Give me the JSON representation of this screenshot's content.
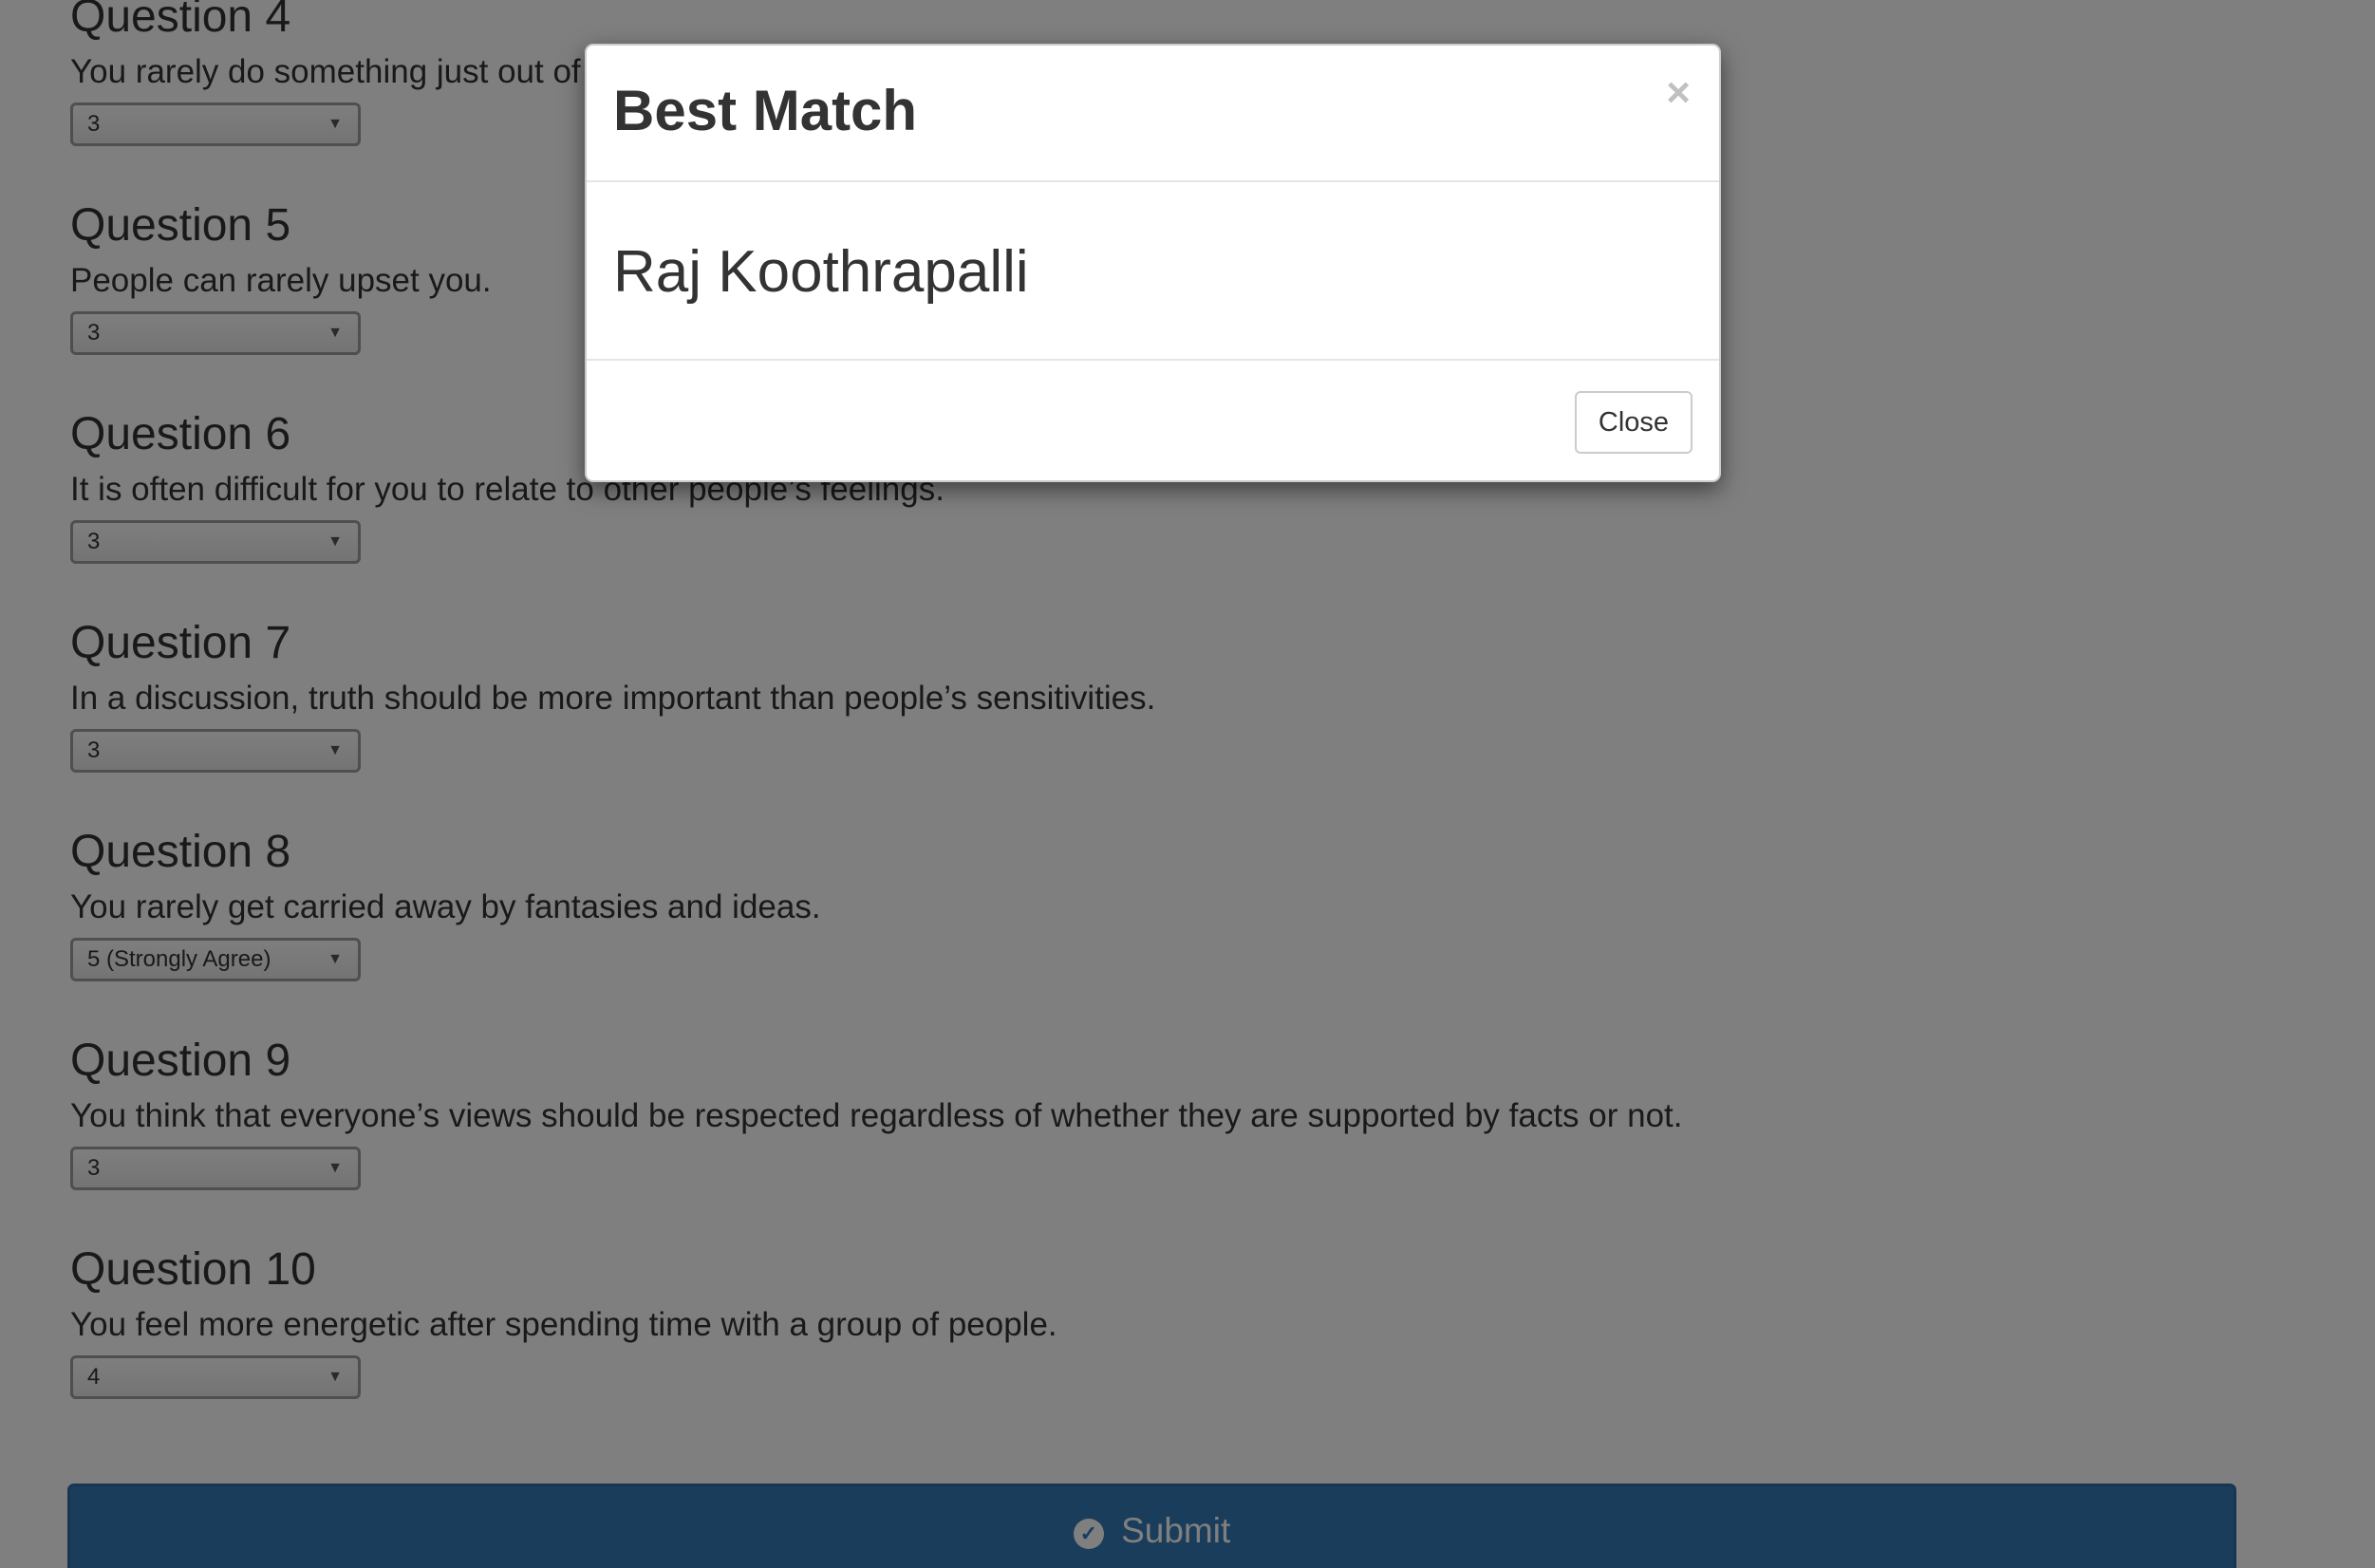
{
  "questions": [
    {
      "title": "Question 4",
      "text": "You rarely do something just out of sheer curiosity.",
      "answer": "3"
    },
    {
      "title": "Question 5",
      "text": "People can rarely upset you.",
      "answer": "3"
    },
    {
      "title": "Question 6",
      "text": "It is often difficult for you to relate to other people’s feelings.",
      "answer": "3"
    },
    {
      "title": "Question 7",
      "text": "In a discussion, truth should be more important than people’s sensitivities.",
      "answer": "3"
    },
    {
      "title": "Question 8",
      "text": "You rarely get carried away by fantasies and ideas.",
      "answer": "5 (Strongly Agree)"
    },
    {
      "title": "Question 9",
      "text": "You think that everyone’s views should be respected regardless of whether they are supported by facts or not.",
      "answer": "3"
    },
    {
      "title": "Question 10",
      "text": "You feel more energetic after spending time with a group of people.",
      "answer": "4"
    }
  ],
  "submit": {
    "label": "Submit",
    "icon": "check-circle-icon"
  },
  "modal": {
    "title": "Best Match",
    "close_x": "×",
    "match_name": "Raj Koothrapalli",
    "close_button": "Close"
  },
  "colors": {
    "primary": "#337ab7",
    "backdrop": "rgba(0,0,0,0.5)"
  }
}
